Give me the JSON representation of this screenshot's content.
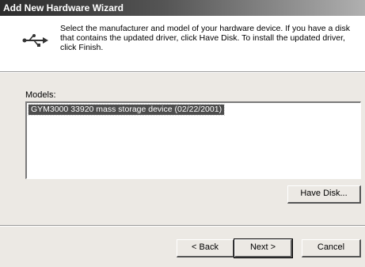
{
  "window": {
    "title": "Add New Hardware Wizard"
  },
  "header": {
    "icon": "usb-icon",
    "instructions": "Select the manufacturer and model of your hardware device. If you have a disk that contains the updated driver, click Have Disk. To install the updated driver, click Finish."
  },
  "models": {
    "label": "Models:",
    "items": [
      "GYM3000 33920 mass storage device (02/22/2001)"
    ],
    "selected_index": 0
  },
  "buttons": {
    "have_disk": "Have Disk...",
    "back": "< Back",
    "next": "Next >",
    "cancel": "Cancel"
  }
}
